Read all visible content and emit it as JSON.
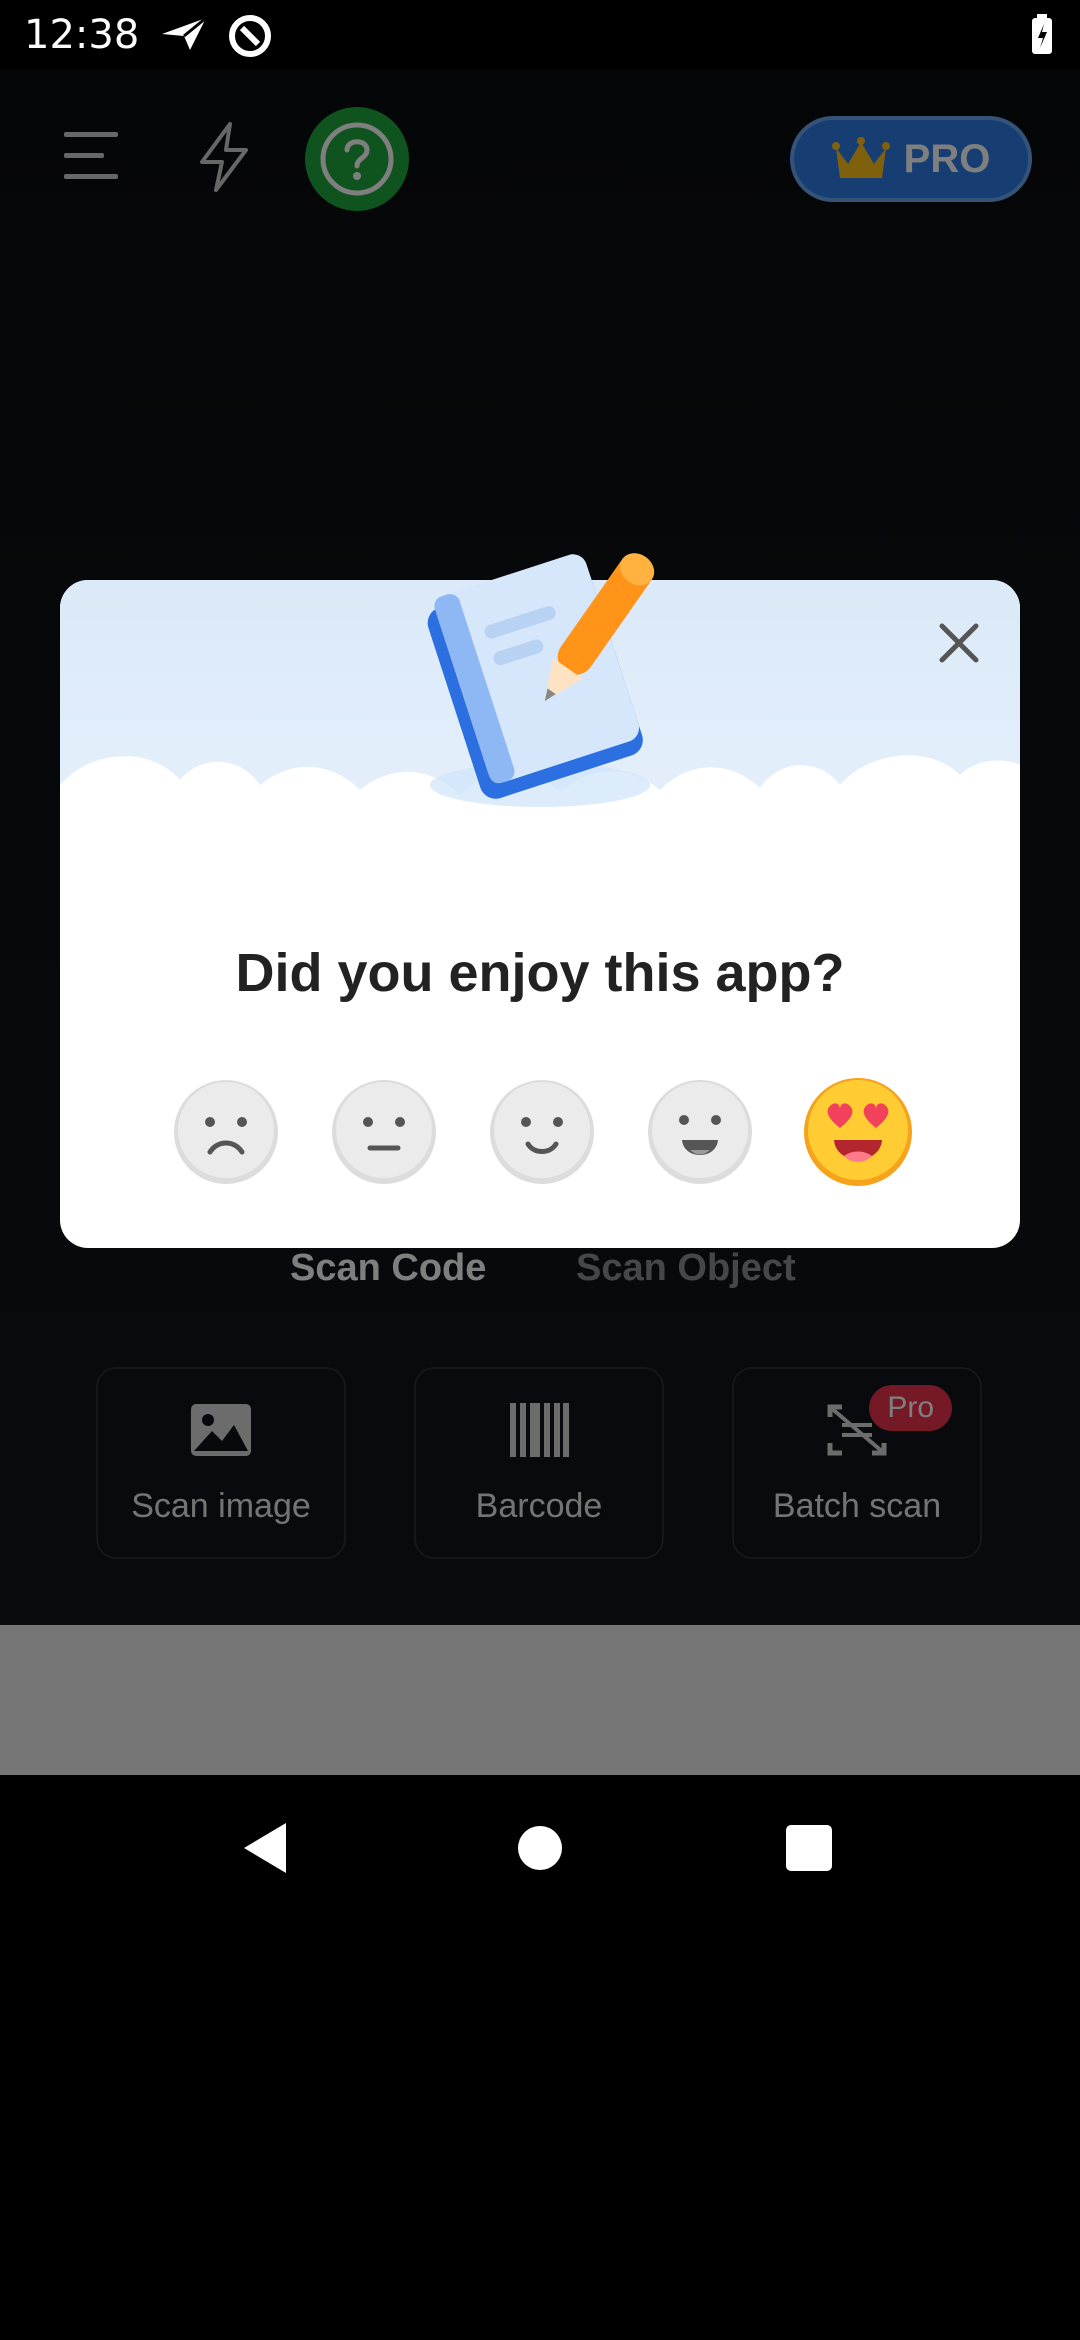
{
  "status_bar": {
    "time": "12:38",
    "icons": [
      "send-icon",
      "at-sign-icon",
      "battery-charging-icon"
    ]
  },
  "top_bar": {
    "menu_icon": "hamburger-menu-icon",
    "flash_icon": "flash-icon",
    "help_icon": "help-icon",
    "pro_label": "PRO",
    "pro_icon": "crown-icon",
    "pro_color": "#2f7de6",
    "help_color": "#1fa83c"
  },
  "scan_tabs": [
    {
      "label": "Scan Code",
      "active": true
    },
    {
      "label": "Scan Object",
      "active": false
    }
  ],
  "tools": [
    {
      "label": "Scan image",
      "icon": "image-icon"
    },
    {
      "label": "Barcode",
      "icon": "barcode-icon"
    },
    {
      "label": "Batch scan",
      "icon": "batch-scan-icon",
      "badge": "Pro"
    }
  ],
  "dialog": {
    "title": "Did you enjoy this app?",
    "close_icon": "close-icon",
    "illustration": "notepad-pencil-icon",
    "ratings": [
      {
        "name": "sad-face-icon",
        "selected": false
      },
      {
        "name": "neutral-face-icon",
        "selected": false
      },
      {
        "name": "smile-face-icon",
        "selected": false
      },
      {
        "name": "grin-face-icon",
        "selected": false
      },
      {
        "name": "heart-eyes-face-icon",
        "selected": true
      }
    ]
  },
  "nav_bar": {
    "back_icon": "back-triangle-icon",
    "home_icon": "home-circle-icon",
    "recents_icon": "recents-square-icon"
  }
}
